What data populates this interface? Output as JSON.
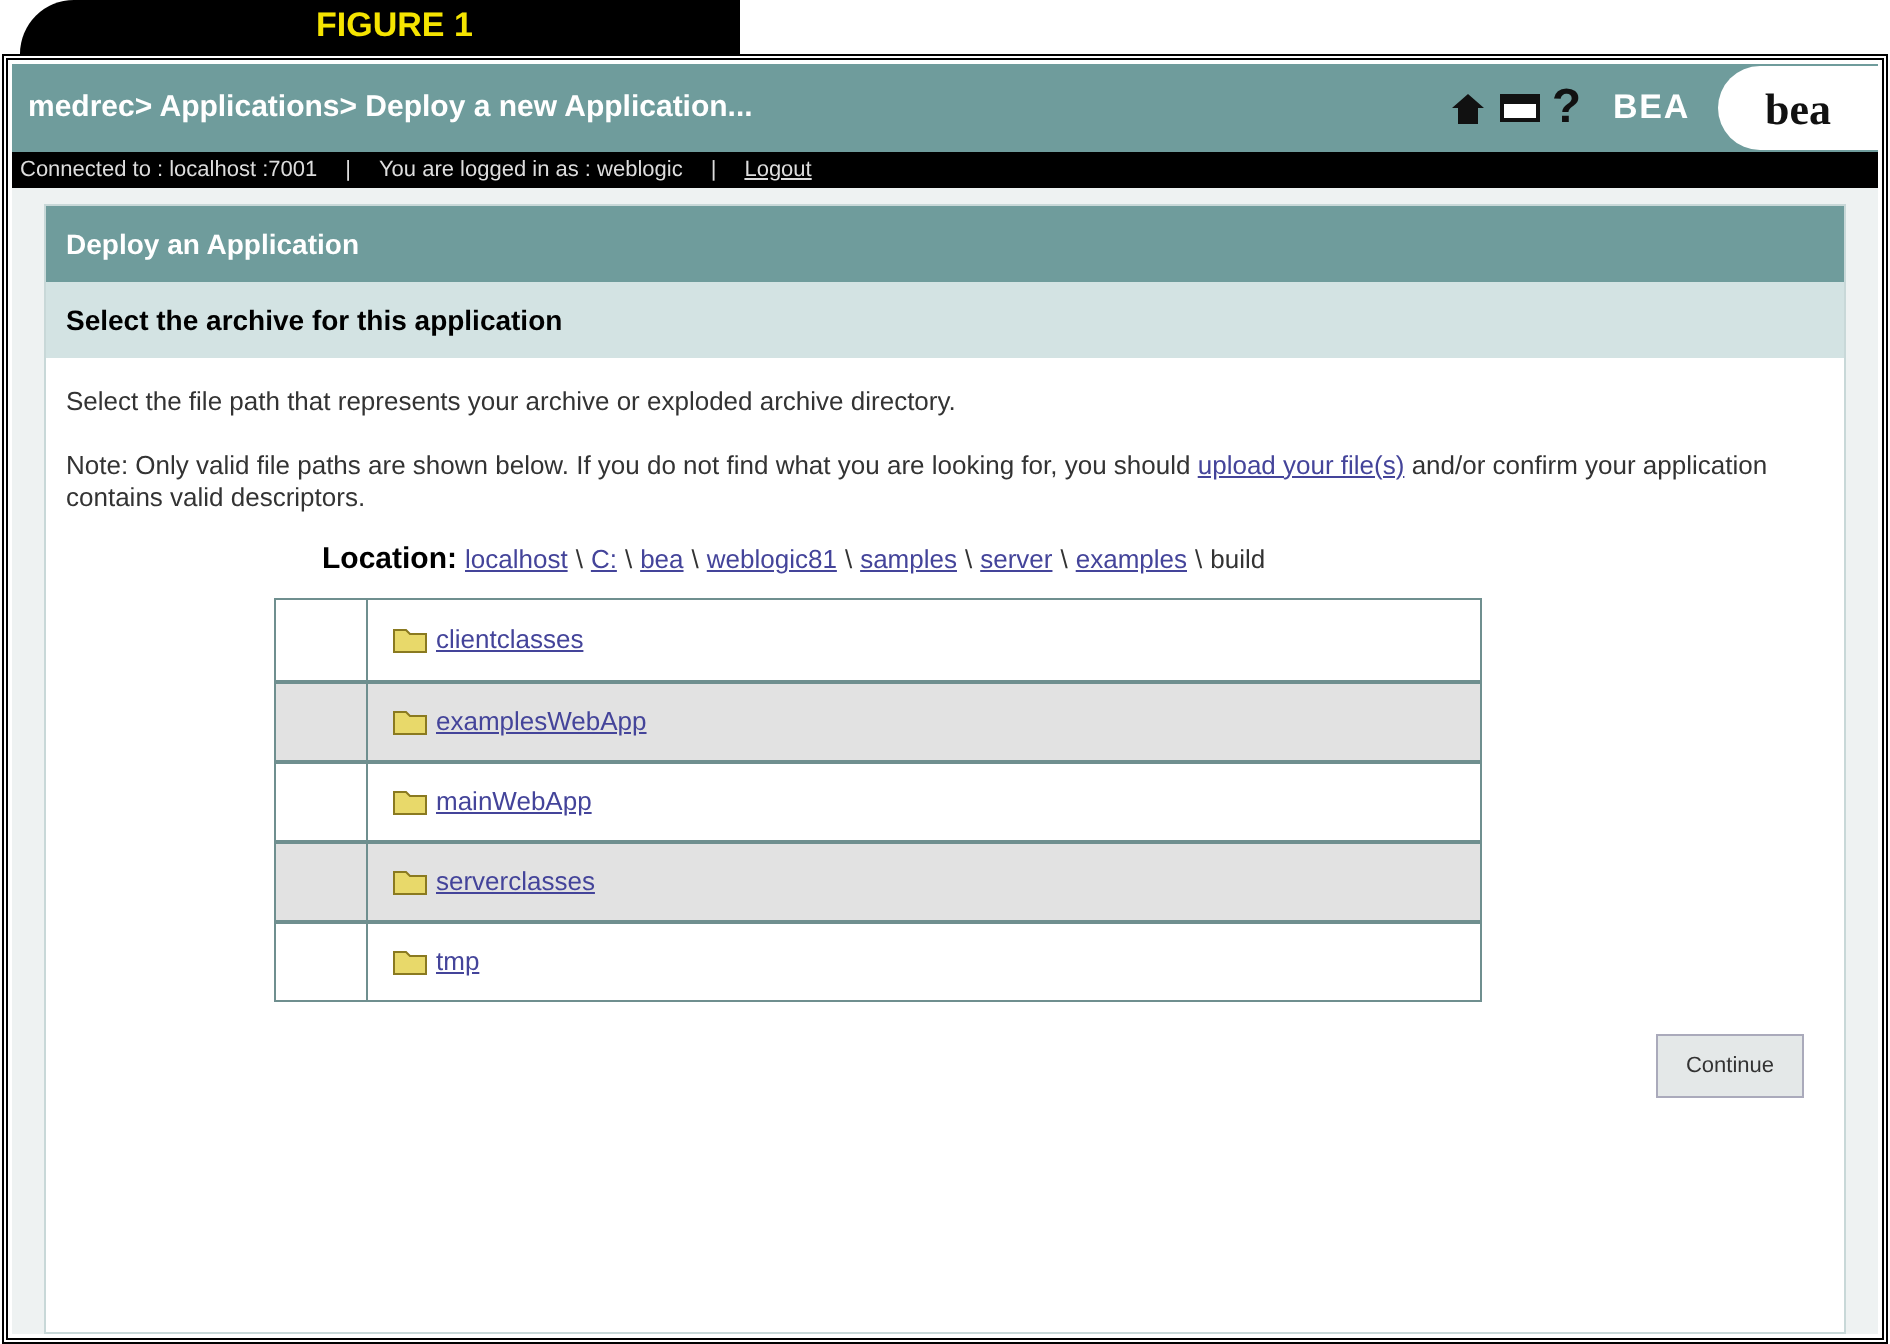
{
  "figure_label": "FIGURE 1",
  "header": {
    "breadcrumb": "medrec> Applications> Deploy a new Application...",
    "help": "?",
    "logo_small": "BEA",
    "logo": "bea"
  },
  "status_bar": {
    "connected": "Connected to :  localhost :7001",
    "separator_1": "|",
    "user": "You are logged in as :  weblogic",
    "separator_2": "|",
    "logout": "Logout"
  },
  "panel": {
    "title": "Deploy an Application",
    "subtitle": "Select the archive for this application",
    "intro": "Select the file path that represents your archive or exploded archive directory.",
    "note": "Note: Only valid file paths are shown below. If you do not find what you are looking for, you should",
    "note_link": "upload your file(s)",
    "note_end": "and/or confirm your application contains valid descriptors.",
    "location_label": "Location:",
    "location": [
      {
        "text": "localhost",
        "link": true
      },
      {
        "text": "C:",
        "link": true
      },
      {
        "text": "bea",
        "link": true
      },
      {
        "text": "weblogic81",
        "link": true
      },
      {
        "text": "samples",
        "link": true
      },
      {
        "text": "server",
        "link": true
      },
      {
        "text": "examples",
        "link": true
      },
      {
        "text": "build",
        "link": false
      }
    ],
    "location_separator": "\\",
    "folders": [
      "clientclasses",
      "examplesWebApp",
      "mainWebApp",
      "serverclasses",
      "tmp"
    ],
    "button": "Continue"
  }
}
